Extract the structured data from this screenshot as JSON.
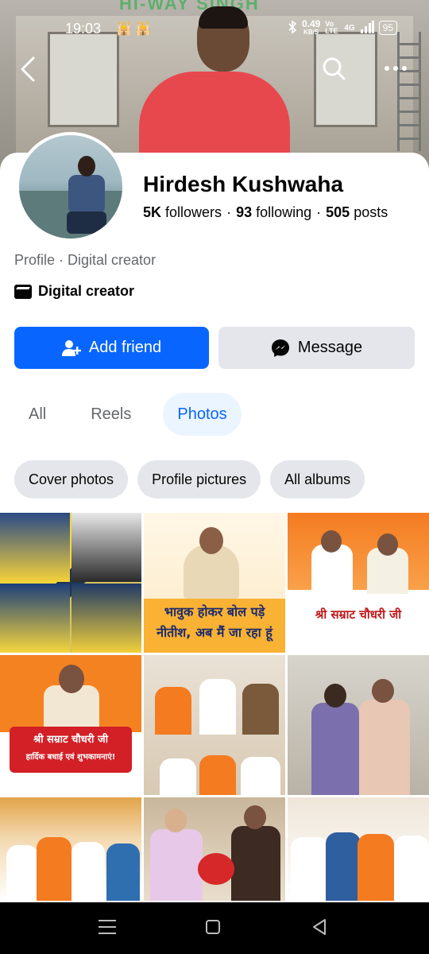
{
  "status_bar": {
    "time": "19:03",
    "notification_icons": "🕌 🕌",
    "network_speed_value": "0.49",
    "network_speed_unit": "KB/S",
    "volte": "Vo LTE",
    "network_type": "4G",
    "battery": "95"
  },
  "cover": {
    "sign_text": "HI-WAY SINGH"
  },
  "profile": {
    "name": "Hirdesh Kushwaha",
    "followers_count": "5K",
    "followers_label": "followers",
    "following_count": "93",
    "following_label": "following",
    "posts_count": "505",
    "posts_label": "posts",
    "separator": "·",
    "subtitle": "Profile · Digital creator",
    "category": "Digital creator"
  },
  "actions": {
    "add_friend_label": "Add friend",
    "message_label": "Message"
  },
  "tabs": [
    {
      "label": "All",
      "active": false
    },
    {
      "label": "Reels",
      "active": false
    },
    {
      "label": "Photos",
      "active": true
    }
  ],
  "chips": [
    {
      "label": "Cover photos"
    },
    {
      "label": "Profile pictures"
    },
    {
      "label": "All albums"
    }
  ],
  "photos": {
    "photo2_caption_line1": "भावुक होकर बोल पड़े",
    "photo2_caption_line2": "नीतीश, अब मैं जा रहा हूं",
    "photo3_caption": "श्री सम्राट चौधरी जी",
    "photo4_caption_line1": "श्री सम्राट चौधरी जी",
    "photo4_caption_line2": "हार्दिक बधाई एवं शुभकामनाएं!"
  },
  "colors": {
    "primary_blue": "#0866ff",
    "secondary_gray": "#e4e6eb",
    "active_tab_bg": "#ebf5ff",
    "text_secondary": "#65676b"
  }
}
